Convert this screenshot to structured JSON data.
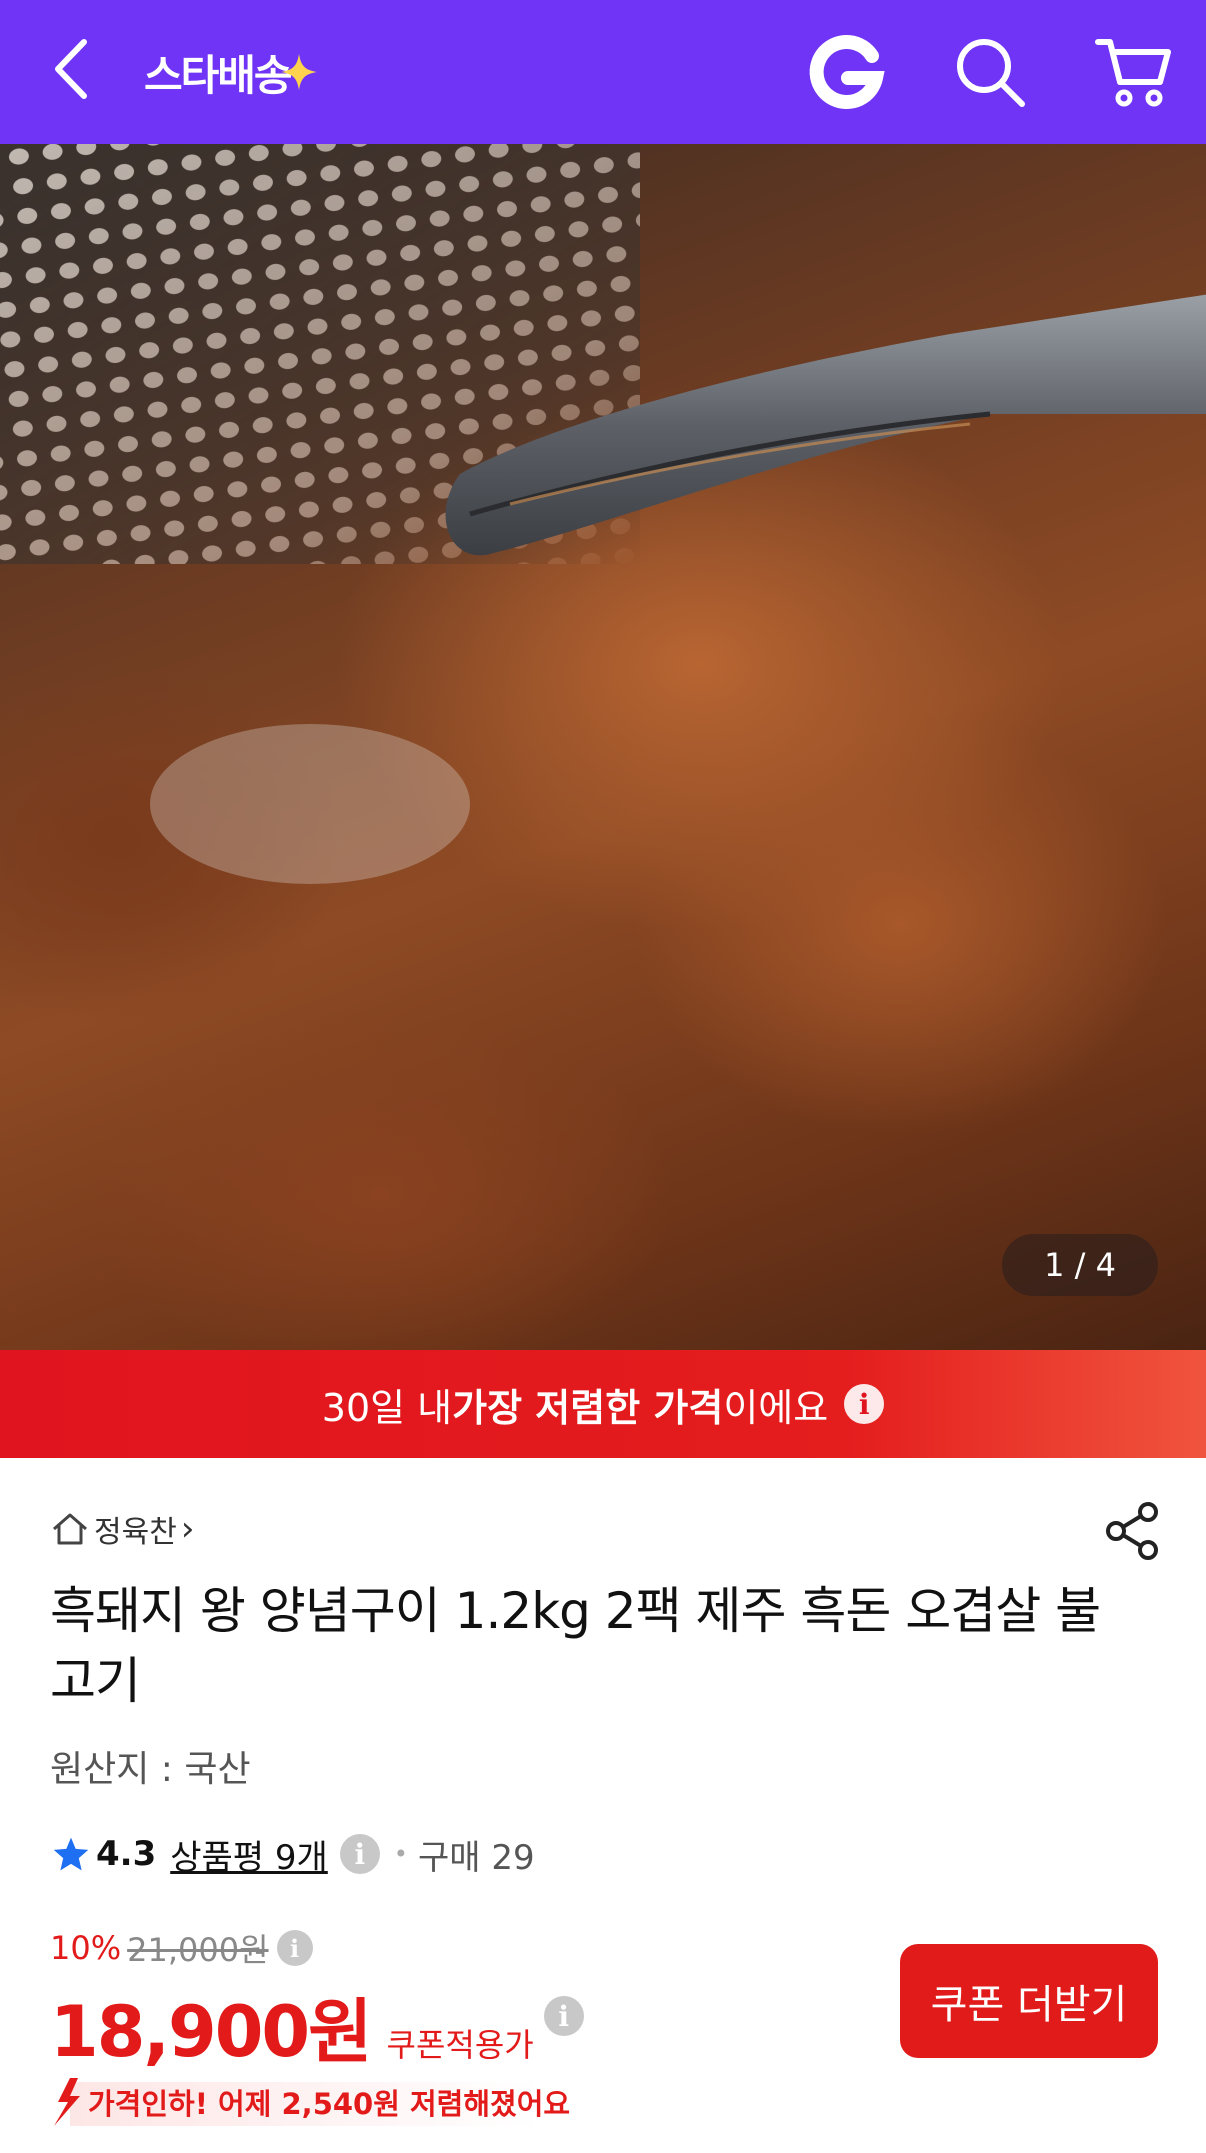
{
  "header": {
    "logo_text": "스타배송",
    "accent_color": "#6f34f5",
    "icons": [
      "back-icon",
      "g-logo-icon",
      "search-icon",
      "cart-icon"
    ]
  },
  "gallery": {
    "pager": "1 / 4"
  },
  "banner": {
    "prefix": "30일 내 ",
    "highlight": "가장 저렴한 가격",
    "suffix": "이에요",
    "info": "i"
  },
  "product": {
    "store_name": "정육찬",
    "store_chevron": "›",
    "title": "흑돼지 왕 양념구이 1.2kg 2팩 제주 흑돈 오겹살 불고기",
    "origin": "원산지 : 국산",
    "rating": "4.3",
    "reviews": "상품평 9개",
    "purchases": "구매 29",
    "discount": "10%",
    "original_price": "21,000원",
    "price": "18,900원",
    "price_note": "쿠폰적용가",
    "coupon_button": "쿠폰 더받기",
    "price_drop": "가격인하! 어제 2,540원 저렴해졌어요"
  },
  "colors": {
    "brand_purple": "#6f34f5",
    "sale_red": "#e21a1a",
    "star_blue": "#1f6ff2"
  }
}
